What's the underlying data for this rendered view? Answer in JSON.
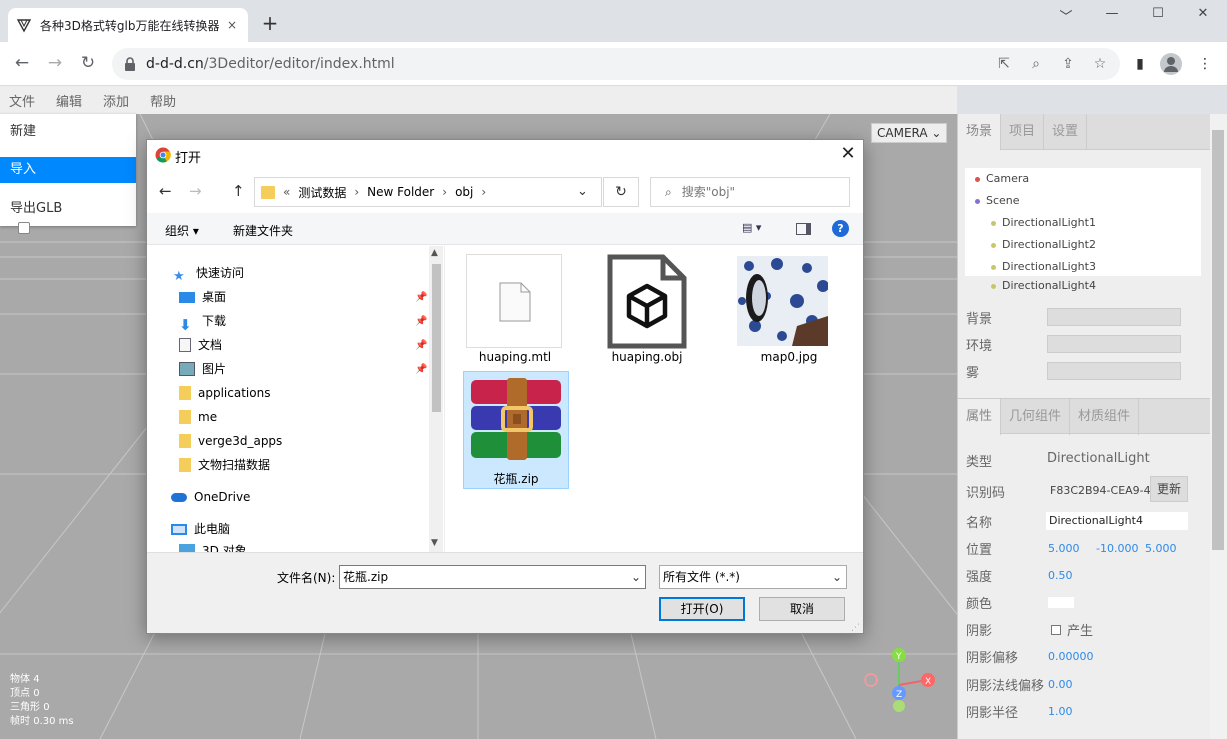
{
  "browser": {
    "tab_title": "各种3D格式转glb万能在线转换器",
    "tab_close": "×",
    "new_tab": "+",
    "url_host": "d-d-d.cn",
    "url_path": "/3Deditor/editor/index.html",
    "window_controls": [
      "﹀",
      "—",
      "☐",
      "✕"
    ]
  },
  "editor": {
    "menu": [
      "文件",
      "编辑",
      "添加",
      "帮助"
    ],
    "file_menu": [
      "新建",
      "导入",
      "导出GLB"
    ],
    "camera_select": "CAMERA",
    "stats": [
      {
        "label": "物体",
        "value": "4"
      },
      {
        "label": "顶点",
        "value": "0"
      },
      {
        "label": "三角形",
        "value": "0"
      },
      {
        "label": "帧时",
        "value": "0.30 ms"
      }
    ]
  },
  "sidebar": {
    "top_tabs": [
      "场景",
      "项目",
      "设置"
    ],
    "outliner": [
      {
        "name": "Camera",
        "color": "#d9534f",
        "indent": 0
      },
      {
        "name": "Scene",
        "color": "#8a6fd1",
        "indent": 0
      },
      {
        "name": "DirectionalLight1",
        "color": "#c7c76a",
        "indent": 1
      },
      {
        "name": "DirectionalLight2",
        "color": "#c7c76a",
        "indent": 1
      },
      {
        "name": "DirectionalLight3",
        "color": "#c7c76a",
        "indent": 1
      },
      {
        "name": "DirectionalLight4",
        "color": "#c7c76a",
        "indent": 1
      }
    ],
    "scene_rows": [
      "背景",
      "环境",
      "雾"
    ],
    "prop_tabs": [
      "属性",
      "几何组件",
      "材质组件"
    ],
    "props": {
      "type_label": "类型",
      "type_value": "DirectionalLight",
      "uuid_label": "识别码",
      "uuid_value": "F83C2B94-CEA9-4",
      "uuid_button": "更新",
      "name_label": "名称",
      "name_value": "DirectionalLight4",
      "position_label": "位置",
      "position": [
        "5.000",
        "-10.000",
        "5.000"
      ],
      "intensity_label": "强度",
      "intensity": "0.50",
      "color_label": "颜色",
      "shadow_label": "阴影",
      "shadow_cast": "产生",
      "shadow_bias_label": "阴影偏移",
      "shadow_bias": "0.00000",
      "shadow_normal_label": "阴影法线偏移",
      "shadow_normal": "0.00",
      "shadow_radius_label": "阴影半径",
      "shadow_radius": "1.00"
    }
  },
  "dialog": {
    "title": "打开",
    "close": "✕",
    "breadcrumb": [
      "测试数据",
      "New Folder",
      "obj"
    ],
    "search_placeholder": "搜索\"obj\"",
    "organize": "组织 ▾",
    "new_folder": "新建文件夹",
    "nav": [
      {
        "label": "快速访问",
        "type": "star",
        "indent": 0,
        "pinned": false
      },
      {
        "label": "桌面",
        "type": "desktop",
        "indent": 1,
        "pinned": true
      },
      {
        "label": "下载",
        "type": "download",
        "indent": 1,
        "pinned": true
      },
      {
        "label": "文档",
        "type": "doc",
        "indent": 1,
        "pinned": true
      },
      {
        "label": "图片",
        "type": "pictures",
        "indent": 1,
        "pinned": true
      },
      {
        "label": "applications",
        "type": "folder",
        "indent": 1,
        "pinned": false
      },
      {
        "label": "me",
        "type": "folder",
        "indent": 1,
        "pinned": false
      },
      {
        "label": "verge3d_apps",
        "type": "folder",
        "indent": 1,
        "pinned": false
      },
      {
        "label": "文物扫描数据",
        "type": "folder",
        "indent": 1,
        "pinned": false
      },
      {
        "label": "OneDrive",
        "type": "cloud",
        "indent": 0,
        "pinned": false
      },
      {
        "label": "此电脑",
        "type": "pc",
        "indent": 0,
        "pinned": false
      },
      {
        "label": "3D 对象",
        "type": "3d",
        "indent": 1,
        "pinned": false
      }
    ],
    "files": [
      {
        "name": "huaping.mtl",
        "kind": "blank",
        "selected": false
      },
      {
        "name": "huaping.obj",
        "kind": "cube",
        "selected": false
      },
      {
        "name": "map0.jpg",
        "kind": "image",
        "selected": false
      },
      {
        "name": "花瓶.zip",
        "kind": "winrar",
        "selected": true
      }
    ],
    "filename_label": "文件名(N):",
    "filename_value": "花瓶.zip",
    "filetype": "所有文件 (*.*)",
    "open_button": "打开(O)",
    "cancel_button": "取消"
  }
}
